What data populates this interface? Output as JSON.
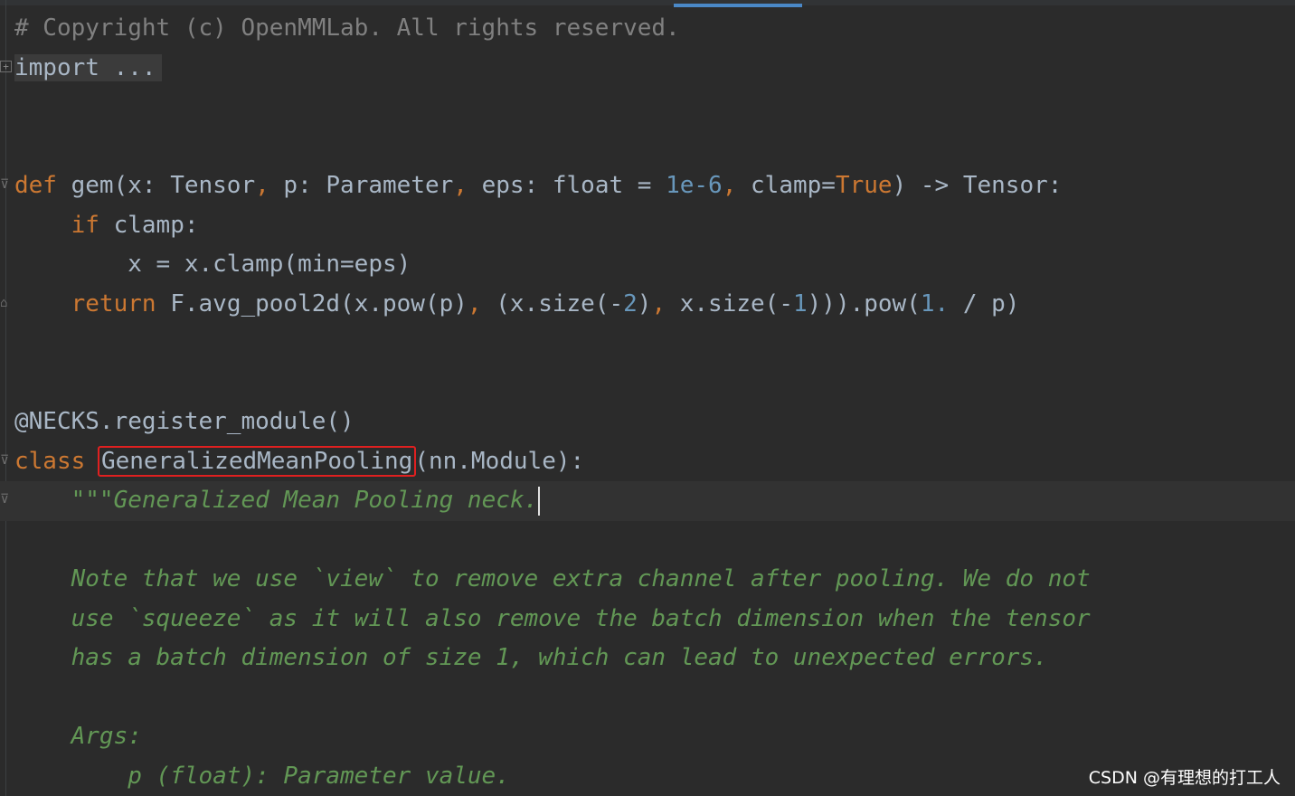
{
  "editor": {
    "lines": {
      "l1": "# Copyright (c) OpenMMLab. All rights reserved.",
      "l2": "import ...",
      "l5_def": "def",
      "l5_a": " gem(x: Tensor",
      "l5_b": ",",
      "l5_c": " p: Parameter",
      "l5_d": ",",
      "l5_e": " eps: float = ",
      "l5_f": "1e-6",
      "l5_g": ",",
      "l5_h": " clamp=",
      "l5_i": "True",
      "l5_j": ") -> Tensor:",
      "l6_indent": "    ",
      "l6_kw": "if",
      "l6_rest": " clamp:",
      "l7": "        x = x.clamp(min=eps)",
      "l8_indent": "    ",
      "l8_kw": "return",
      "l8_a": " F.avg_pool2d(x.pow(p)",
      "l8_b": ",",
      "l8_c": " (x.size(-",
      "l8_d": "2",
      "l8_e": ")",
      "l8_f": ",",
      "l8_g": " x.size(-",
      "l8_h": "1",
      "l8_i": "))).pow(",
      "l8_j": "1.",
      "l8_k": " / p)",
      "l11": "@NECKS.register_module()",
      "l12_kw": "class",
      "l12_space": " ",
      "l12_name": "GeneralizedMeanPooling",
      "l12_rest": "(nn.Module):",
      "l13_indent": "    ",
      "l13_doc": "\"\"\"Generalized Mean Pooling neck.",
      "l15": "    Note that we use `view` to remove extra channel after pooling. We do not",
      "l16": "    use `squeeze` as it will also remove the batch dimension when the tensor",
      "l17": "    has a batch dimension of size 1, which can lead to unexpected errors.",
      "l19": "    Args:",
      "l20": "        p (float): Parameter value."
    }
  },
  "watermark": "CSDN @有理想的打工人",
  "colors": {
    "background": "#2b2b2b",
    "keyword": "#cc7832",
    "number": "#6897bb",
    "comment": "#808080",
    "docstring": "#629755",
    "highlight_border": "#e02020"
  }
}
